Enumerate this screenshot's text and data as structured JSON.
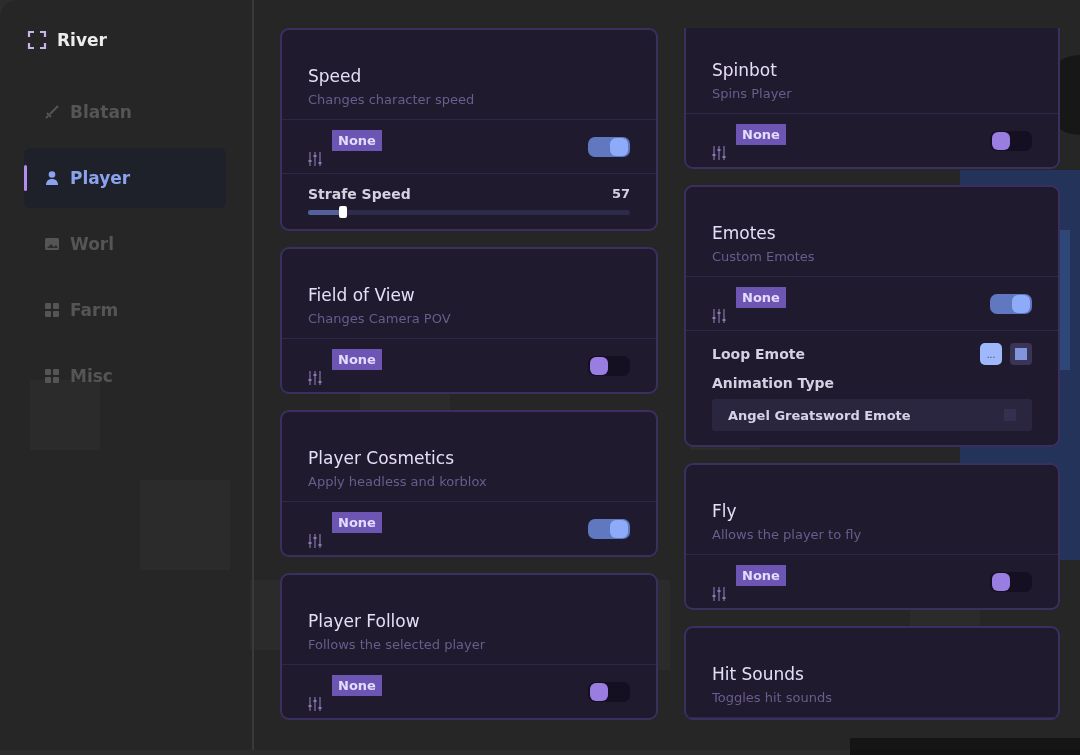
{
  "app": {
    "title": "River"
  },
  "sidebar": {
    "items": [
      {
        "label": "Blatan",
        "selected": false
      },
      {
        "label": "Player",
        "selected": true
      },
      {
        "label": "Worl",
        "selected": false
      },
      {
        "label": "Farm",
        "selected": false
      },
      {
        "label": "Misc",
        "selected": false
      }
    ]
  },
  "columns": [
    {
      "cards": [
        {
          "title": "Speed",
          "description": "Changes character speed",
          "keybind": "None",
          "on": true,
          "extras": [
            {
              "kind": "slider",
              "label": "Strafe Speed",
              "value": "57",
              "level": 0.11
            }
          ]
        },
        {
          "title": "Field of View",
          "description": "Changes Camera POV",
          "keybind": "None",
          "on": false
        },
        {
          "title": "Player Cosmetics",
          "description": "Apply headless and korblox",
          "keybind": "None",
          "on": true
        },
        {
          "title": "Player Follow",
          "description": "Follows the selected player",
          "keybind": "None",
          "on": false
        }
      ]
    },
    {
      "cards": [
        {
          "title": "Spinbot",
          "description": "Spins Player",
          "keybind": "None",
          "on": false
        },
        {
          "title": "Emotes",
          "description": "Custom Emotes",
          "keybind": "None",
          "on": true,
          "extras": [
            {
              "kind": "checkbox",
              "label": "Loop Emote",
              "button": "...",
              "checked": true
            },
            {
              "kind": "dropdown",
              "label": "Animation Type",
              "value": "Angel Greatsword Emote"
            }
          ]
        },
        {
          "title": "Fly",
          "description": "Allows the player to fly",
          "keybind": "None",
          "on": false
        },
        {
          "title": "Hit Sounds",
          "description": "Toggles hit sounds"
        }
      ]
    }
  ]
}
